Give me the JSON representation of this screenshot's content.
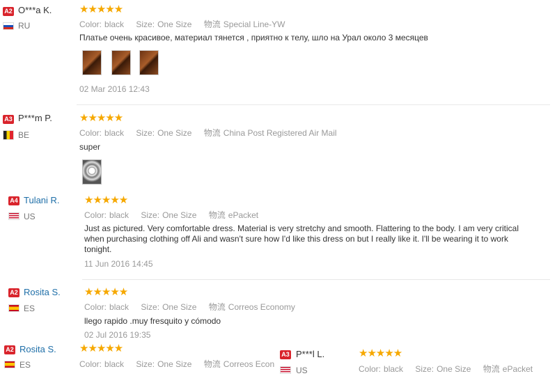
{
  "labels": {
    "color": "Color:",
    "size": "Size:",
    "shipping": "物流"
  },
  "stars": "★★★★★",
  "reviews": [
    {
      "badge": "A2",
      "name": "O***a K.",
      "country": "RU",
      "color": "black",
      "size": "One Size",
      "shipping": "Special Line-YW",
      "text": "Платье очень красивое, материал тянется , приятно к телу, шло на Урал около 3 месяцев",
      "date": "02 Mar 2016 12:43"
    },
    {
      "badge": "A3",
      "name": "P***m P.",
      "country": "BE",
      "color": "black",
      "size": "One Size",
      "shipping": "China Post Registered Air Mail",
      "text": "super",
      "date": ""
    },
    {
      "badge": "A4",
      "name": "Tulani R.",
      "country": "US",
      "color": "black",
      "size": "One Size",
      "shipping": "ePacket",
      "text": "Just as pictured. Very comfortable dress. Material is very stretchy and smooth. Flattering to the body. I am very critical when purchasing clothing off Ali and wasn't sure how I'd like this dress on but I really like it. I'll be wearing it to work tonight.",
      "date": "11 Jun 2016 14:45"
    },
    {
      "badge": "A2",
      "name": "Rosita S.",
      "country": "ES",
      "color": "black",
      "size": "One Size",
      "shipping": "Correos Economy",
      "text": "llego rapido .muy fresquito y cómodo",
      "date": "02 Jul 2016 19:35"
    },
    {
      "badge": "A2",
      "name": "Rosita S.",
      "country": "ES",
      "color": "black",
      "size": "One Size",
      "shipping": "Correos Econom",
      "text": "",
      "date": ""
    },
    {
      "badge": "A3",
      "name": "P***l L.",
      "country": "US",
      "color": "black",
      "size": "One Size",
      "shipping": "ePacket",
      "text": "",
      "date": ""
    }
  ],
  "colors": {
    "badge": "#d9242c",
    "star": "#f6a800",
    "link": "#1f6fa8"
  }
}
